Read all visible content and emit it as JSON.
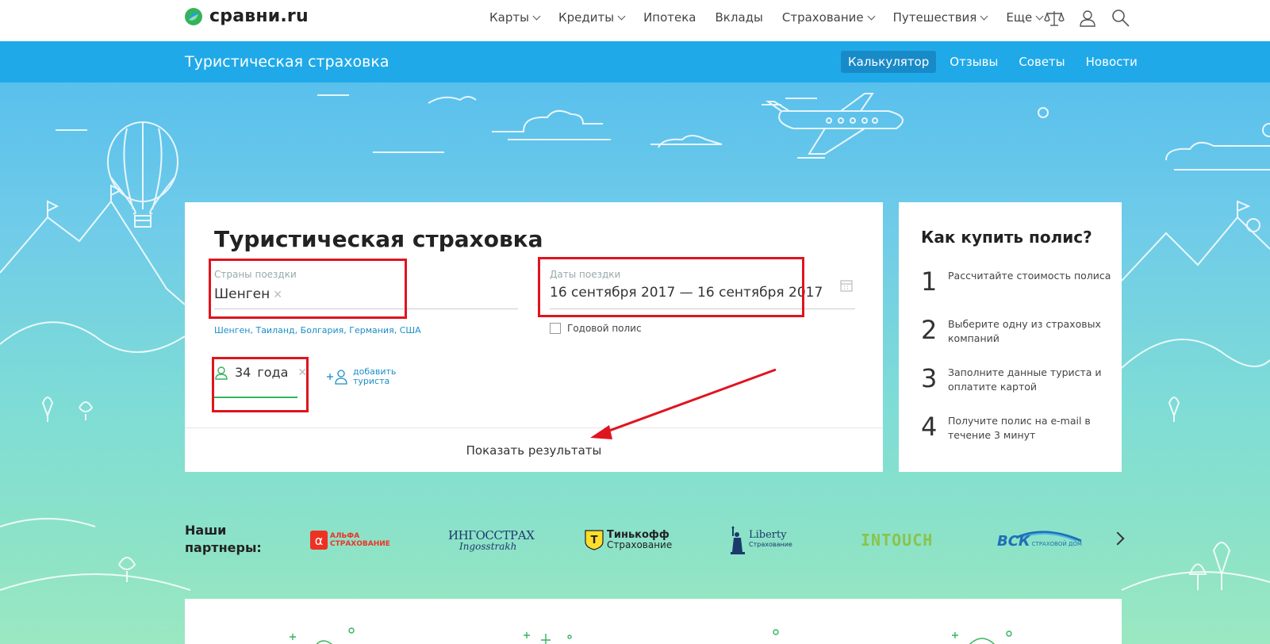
{
  "header": {
    "logo_text": "сравни.ru",
    "nav": [
      {
        "label": "Карты",
        "dropdown": true
      },
      {
        "label": "Кредиты",
        "dropdown": true
      },
      {
        "label": "Ипотека",
        "dropdown": false
      },
      {
        "label": "Вклады",
        "dropdown": false
      },
      {
        "label": "Страхование",
        "dropdown": true
      },
      {
        "label": "Путешествия",
        "dropdown": true
      },
      {
        "label": "Еще",
        "dropdown": true
      }
    ],
    "icons": [
      "compare-scales-icon",
      "user-icon",
      "search-icon"
    ]
  },
  "subheader": {
    "title": "Туристическая страховка",
    "tabs": [
      "Калькулятор",
      "Отзывы",
      "Советы",
      "Новости"
    ],
    "active_tab": "Калькулятор"
  },
  "calculator": {
    "title": "Туристическая страховка",
    "countries_label": "Страны поездки",
    "countries_value": "Шенген",
    "country_suggestions": [
      "Шенген",
      "Таиланд",
      "Болгария",
      "Германия",
      "США"
    ],
    "dates_label": "Даты поездки",
    "dates_value": "16 сентября 2017 — 16 сентября 2017",
    "annual_policy_label": "Годовой полис",
    "annual_policy_checked": false,
    "traveler_age": "34",
    "traveler_age_unit": "года",
    "add_tourist_line1": "добавить",
    "add_tourist_line2": "туриста",
    "show_results": "Показать результаты"
  },
  "how_to_buy": {
    "title": "Как купить полис?",
    "steps": [
      {
        "num": "1",
        "text": "Рассчитайте стоимость полиса"
      },
      {
        "num": "2",
        "text": "Выберите одну из страховых компаний"
      },
      {
        "num": "3",
        "text": "Заполните данные туриста и оплатите картой"
      },
      {
        "num": "4",
        "text": "Получите полис на e-mail в течение 3 минут"
      }
    ]
  },
  "partners": {
    "label": "Наши партнеры:",
    "logos": [
      {
        "name": "АЛЬФА СТРАХОВАНИЕ",
        "line1": "АЛЬФА",
        "line2": "СТРАХОВАНИЕ",
        "color": "#ef3124"
      },
      {
        "name": "ИНГОССТРАХ",
        "line1": "ИНГОССТРАХ",
        "line2": "Ingosstrakh",
        "color": "#1d3a6e"
      },
      {
        "name": "Тинькофф Страхование",
        "line1": "Тинькофф",
        "line2": "Страхование",
        "color": "#222222"
      },
      {
        "name": "Liberty Страхование",
        "line1": "Liberty",
        "line2": "Страхование",
        "color": "#1b3a6b"
      },
      {
        "name": "INTOUCH",
        "line1": "INTOUCH",
        "line2": "",
        "color": "#8bc34a"
      },
      {
        "name": "ВСК Страховой дом",
        "line1": "ВСК",
        "line2": "СТРАХОВОЙ ДОМ",
        "color": "#1f6fb5"
      }
    ]
  },
  "colors": {
    "accent": "#1fa9e9",
    "highlight": "#e0141e",
    "green": "#35b45c",
    "link": "#1a8fc9"
  }
}
